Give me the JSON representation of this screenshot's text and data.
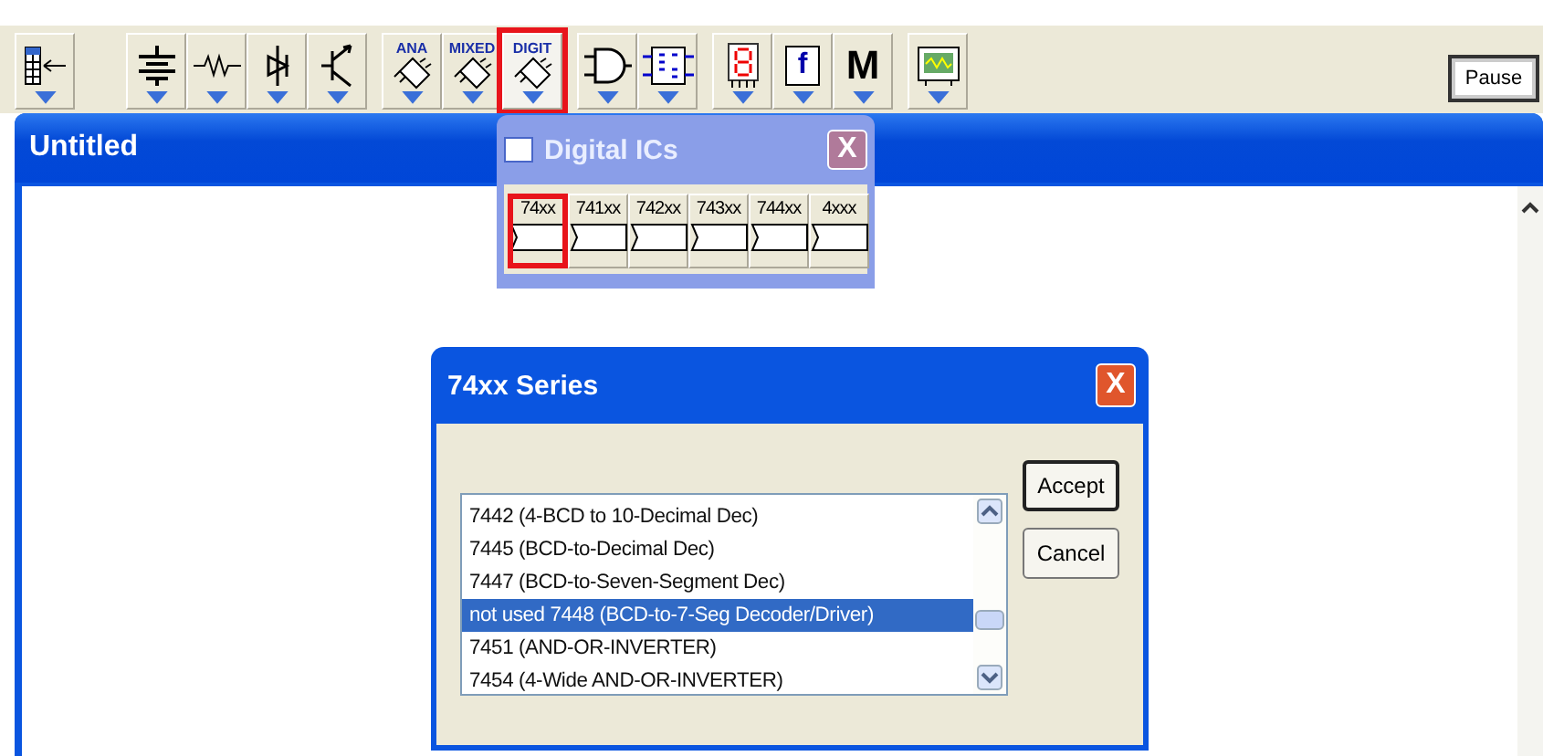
{
  "toolbar": {
    "buttons": [
      {
        "kind": "parts",
        "selected": false
      },
      {
        "kind": "battery",
        "selected": false
      },
      {
        "kind": "resistor",
        "selected": false
      },
      {
        "kind": "diode",
        "selected": false
      },
      {
        "kind": "transistor",
        "selected": false
      },
      {
        "kind": "chip",
        "label": "ANA",
        "selected": false
      },
      {
        "kind": "chip",
        "label": "MIXED",
        "selected": false
      },
      {
        "kind": "chip",
        "label": "DIGIT",
        "selected": true
      },
      {
        "kind": "gate",
        "selected": false
      },
      {
        "kind": "flipflop",
        "selected": false
      },
      {
        "kind": "segment",
        "selected": false
      },
      {
        "kind": "func",
        "label": "f",
        "selected": false
      },
      {
        "kind": "letter",
        "label": "M",
        "selected": false
      },
      {
        "kind": "scope",
        "selected": false
      }
    ],
    "pause": "Pause"
  },
  "main_window": {
    "title": "Untitled"
  },
  "digital_ics": {
    "title": "Digital ICs",
    "close": "X",
    "series": [
      {
        "label": "74xx",
        "selected": true
      },
      {
        "label": "741xx",
        "selected": false
      },
      {
        "label": "742xx",
        "selected": false
      },
      {
        "label": "743xx",
        "selected": false
      },
      {
        "label": "744xx",
        "selected": false
      },
      {
        "label": "4xxx",
        "selected": false
      }
    ]
  },
  "series_dialog": {
    "title": "74xx Series",
    "close": "X",
    "items": [
      {
        "label": "7442 (4-BCD to 10-Decimal Dec)",
        "selected": false
      },
      {
        "label": "7445 (BCD-to-Decimal Dec)",
        "selected": false
      },
      {
        "label": "7447 (BCD-to-Seven-Segment Dec)",
        "selected": false
      },
      {
        "label": "not used 7448 (BCD-to-7-Seg Decoder/Driver)",
        "selected": true
      },
      {
        "label": "7451 (AND-OR-INVERTER)",
        "selected": false
      },
      {
        "label": "7454 (4-Wide AND-OR-INVERTER)",
        "selected": false
      }
    ],
    "buttons": [
      "Accept",
      "Cancel"
    ]
  }
}
